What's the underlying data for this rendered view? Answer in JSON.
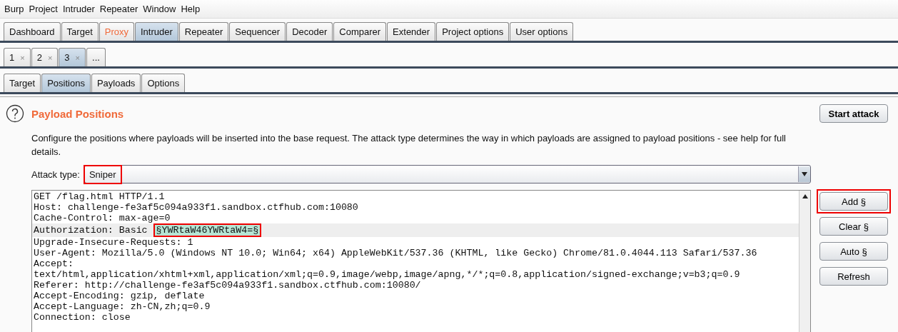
{
  "menu": [
    "Burp",
    "Project",
    "Intruder",
    "Repeater",
    "Window",
    "Help"
  ],
  "main_tabs": [
    {
      "label": "Dashboard",
      "selected": false,
      "alert": false
    },
    {
      "label": "Target",
      "selected": false,
      "alert": false
    },
    {
      "label": "Proxy",
      "selected": false,
      "alert": true
    },
    {
      "label": "Intruder",
      "selected": true,
      "alert": false
    },
    {
      "label": "Repeater",
      "selected": false,
      "alert": false
    },
    {
      "label": "Sequencer",
      "selected": false,
      "alert": false
    },
    {
      "label": "Decoder",
      "selected": false,
      "alert": false
    },
    {
      "label": "Comparer",
      "selected": false,
      "alert": false
    },
    {
      "label": "Extender",
      "selected": false,
      "alert": false
    },
    {
      "label": "Project options",
      "selected": false,
      "alert": false
    },
    {
      "label": "User options",
      "selected": false,
      "alert": false
    }
  ],
  "attack_tabs": [
    {
      "label": "1",
      "close": "×",
      "selected": false
    },
    {
      "label": "2",
      "close": "×",
      "selected": false
    },
    {
      "label": "3",
      "close": "×",
      "selected": true
    }
  ],
  "new_tab": "...",
  "sub_tabs": [
    {
      "label": "Target",
      "selected": false
    },
    {
      "label": "Positions",
      "selected": true
    },
    {
      "label": "Payloads",
      "selected": false
    },
    {
      "label": "Options",
      "selected": false
    }
  ],
  "panel": {
    "title": "Payload Positions",
    "description": "Configure the positions where payloads will be inserted into the base request. The attack type determines the way in which payloads are assigned to payload positions - see help for full details.",
    "start_button": "Start attack",
    "attack_type": {
      "label": "Attack type:",
      "value": "Sniper",
      "highlighted": true
    },
    "request_lines": [
      {
        "text": "GET /flag.html HTTP/1.1",
        "current": false
      },
      {
        "text": "Host: challenge-fe3af5c094a933f1.sandbox.ctfhub.com:10080",
        "current": false
      },
      {
        "text": "Cache-Control: max-age=0",
        "current": false
      },
      {
        "text": "Authorization: Basic ",
        "payload": "§YWRtaW46YWRtaW4=§",
        "payload_highlighted": true,
        "current": true
      },
      {
        "text": "Upgrade-Insecure-Requests: 1",
        "current": false
      },
      {
        "text": "User-Agent: Mozilla/5.0 (Windows NT 10.0; Win64; x64) AppleWebKit/537.36 (KHTML, like Gecko) Chrome/81.0.4044.113 Safari/537.36",
        "current": false
      },
      {
        "text": "Accept:",
        "current": false
      },
      {
        "text": "text/html,application/xhtml+xml,application/xml;q=0.9,image/webp,image/apng,*/*;q=0.8,application/signed-exchange;v=b3;q=0.9",
        "current": false
      },
      {
        "text": "Referer: http://challenge-fe3af5c094a933f1.sandbox.ctfhub.com:10080/",
        "current": false
      },
      {
        "text": "Accept-Encoding: gzip, deflate",
        "current": false
      },
      {
        "text": "Accept-Language: zh-CN,zh;q=0.9",
        "current": false
      },
      {
        "text": "Connection: close",
        "current": false
      }
    ],
    "side_buttons": [
      {
        "label": "Add §",
        "highlighted": true
      },
      {
        "label": "Clear §",
        "highlighted": false
      },
      {
        "label": "Auto §",
        "highlighted": false
      },
      {
        "label": "Refresh",
        "highlighted": false
      }
    ]
  }
}
